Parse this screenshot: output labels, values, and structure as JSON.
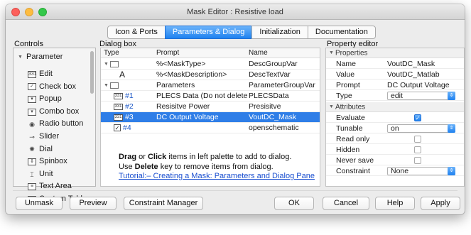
{
  "window": {
    "title": "Mask Editor : Resistive load"
  },
  "tabs": [
    {
      "label": "Icon & Ports",
      "active": false
    },
    {
      "label": "Parameters & Dialog",
      "active": true
    },
    {
      "label": "Initialization",
      "active": false
    },
    {
      "label": "Documentation",
      "active": false
    }
  ],
  "controls": {
    "title": "Controls",
    "group": "Parameter",
    "items": [
      {
        "label": "Edit",
        "icon": "edit-icon"
      },
      {
        "label": "Check box",
        "icon": "checkbox-icon"
      },
      {
        "label": "Popup",
        "icon": "popup-icon"
      },
      {
        "label": "Combo box",
        "icon": "combobox-icon"
      },
      {
        "label": "Radio button",
        "icon": "radio-button-icon"
      },
      {
        "label": "Slider",
        "icon": "slider-icon"
      },
      {
        "label": "Dial",
        "icon": "dial-icon"
      },
      {
        "label": "Spinbox",
        "icon": "spinbox-icon"
      },
      {
        "label": "Unit",
        "icon": "unit-icon"
      },
      {
        "label": "Text Area",
        "icon": "text-area-icon"
      },
      {
        "label": "Custom Table",
        "icon": "custom-table-icon"
      }
    ]
  },
  "dialog_box": {
    "title": "Dialog box",
    "columns": {
      "type": "Type",
      "prompt": "Prompt",
      "name": "Name"
    },
    "rows": [
      {
        "num": "",
        "prompt": "%<MaskType>",
        "name": "DescGroupVar"
      },
      {
        "num": "A",
        "prompt": "%<MaskDescription>",
        "name": "DescTextVar"
      },
      {
        "num": "",
        "prompt": "Parameters",
        "name": "ParameterGroupVar"
      },
      {
        "num": "#1",
        "prompt": "PLECS Data (Do not delete ...",
        "name": "PLECSData"
      },
      {
        "num": "#2",
        "prompt": "Resisitve Power",
        "name": "Presisitve"
      },
      {
        "num": "#3",
        "prompt": "DC Output Voltage",
        "name": "VoutDC_Mask"
      },
      {
        "num": "#4",
        "prompt": "",
        "name": "openschematic"
      }
    ],
    "hint": {
      "line1_bold1": "Drag",
      "line1_mid": " or ",
      "line1_bold2": "Click",
      "line1_rest": " items in left palette to add to dialog.",
      "line2_pre": "Use ",
      "line2_bold": "Delete",
      "line2_rest": " key to remove items from dialog.",
      "link": "Tutorial:– Creating a Mask: Parameters and Dialog Pane"
    }
  },
  "property_editor": {
    "title": "Property editor",
    "properties_header": "Properties",
    "properties": [
      {
        "key": "Name",
        "value": "VoutDC_Mask"
      },
      {
        "key": "Value",
        "value": "VoutDC_Matlab"
      },
      {
        "key": "Prompt",
        "value": "DC Output Voltage"
      },
      {
        "key": "Type",
        "value": "edit"
      }
    ],
    "attributes_header": "Attributes",
    "attributes": [
      {
        "key": "Evaluate",
        "checked": true
      },
      {
        "key": "Tunable",
        "value": "on"
      },
      {
        "key": "Read only",
        "checked": false
      },
      {
        "key": "Hidden",
        "checked": false
      },
      {
        "key": "Never save",
        "checked": false
      },
      {
        "key": "Constraint",
        "value": "None"
      }
    ]
  },
  "buttons": {
    "unmask": "Unmask",
    "preview": "Preview",
    "constraint_manager": "Constraint Manager",
    "ok": "OK",
    "cancel": "Cancel",
    "help": "Help",
    "apply": "Apply"
  },
  "colors": {
    "accent": "#2f7ee7",
    "link": "#1a4fd0"
  }
}
